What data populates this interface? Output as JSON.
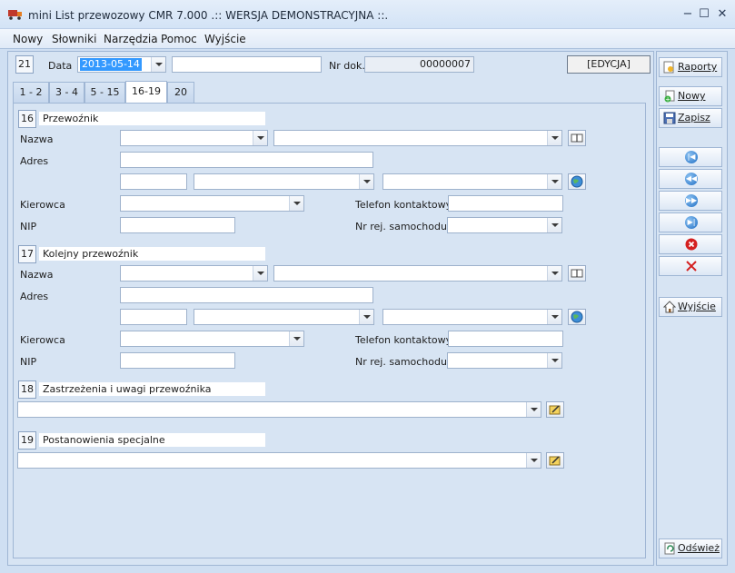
{
  "window": {
    "title": "mini List przewozowy CMR 7.000 .:: WERSJA DEMONSTRACYJNA ::.",
    "minimize": "−",
    "maximize": "☐",
    "close": "✕"
  },
  "menu": [
    "Nowy",
    "Słowniki",
    "Narzędzia",
    "Pomoc",
    "Wyjście"
  ],
  "header": {
    "field_num": "21",
    "date_label": "Data",
    "date_value": "2013-05-14",
    "place_value": "",
    "doc_label": "Nr dok.",
    "doc_value": "00000007",
    "mode": "[EDYCJA]"
  },
  "tabs": [
    "1 - 2",
    "3 - 4",
    "5 - 15",
    "16-19",
    "20"
  ],
  "active_tab": "16-19",
  "section16": {
    "num": "16",
    "title": "Przewoźnik",
    "name_label": "Nazwa",
    "address_label": "Adres",
    "driver_label": "Kierowca",
    "phone_label": "Telefon kontaktowy",
    "nip_label": "NIP",
    "plate_label": "Nr rej. samochodu"
  },
  "section17": {
    "num": "17",
    "title": "Kolejny przewoźnik",
    "name_label": "Nazwa",
    "address_label": "Adres",
    "driver_label": "Kierowca",
    "phone_label": "Telefon kontaktowy",
    "nip_label": "NIP",
    "plate_label": "Nr rej. samochodu"
  },
  "section18": {
    "num": "18",
    "title": "Zastrzeżenia i uwagi przewoźnika"
  },
  "section19": {
    "num": "19",
    "title": "Postanowienia specjalne"
  },
  "sidebar": {
    "reports": "Raporty",
    "new": "Nowy",
    "save": "Zapisz",
    "exit": "Wyjście",
    "refresh": "Odśwież"
  },
  "colors": {
    "accent": "#3399ff",
    "background": "#d7e4f3",
    "delete_red": "#d42020"
  }
}
